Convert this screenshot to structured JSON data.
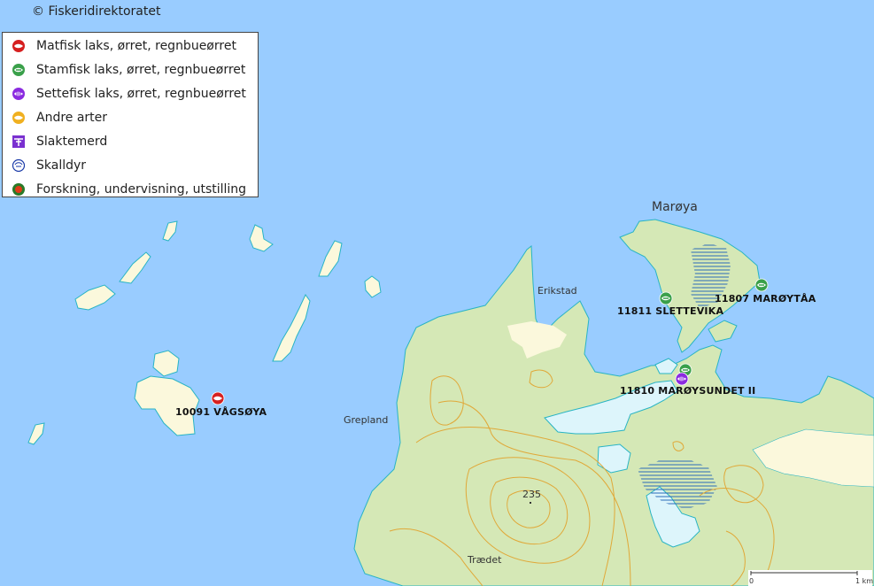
{
  "map": {
    "copyright": "© Fiskeridirektoratet",
    "colors": {
      "sea": "#99ccff",
      "land": "#d5e8b6",
      "open_land": "#fbf8dc",
      "lake": "#ddf5fb",
      "contour": "#e0a838",
      "coast": "#28b4c4"
    }
  },
  "legend": {
    "items": [
      {
        "label": "Matfisk laks, ørret, regnbueørret",
        "icon": "matfisk-icon",
        "color": "#d62020"
      },
      {
        "label": "Stamfisk laks, ørret, regnbueørret",
        "icon": "stamfisk-icon",
        "color": "#3aa04a"
      },
      {
        "label": "Settefisk laks, ørret, regnbueørret",
        "icon": "settefisk-icon",
        "color": "#8b2be0"
      },
      {
        "label": "Andre arter",
        "icon": "andre-arter-icon",
        "color": "#f0b020"
      },
      {
        "label": "Slaktemerd",
        "icon": "slaktemerd-icon",
        "color": "#7a30d0"
      },
      {
        "label": "Skalldyr",
        "icon": "skalldyr-icon",
        "color": "#1a3aa8"
      },
      {
        "label": "Forskning, undervisning, utstilling",
        "icon": "forskning-icon",
        "color": "#e03a18"
      }
    ]
  },
  "places": {
    "maroya": "Marøya",
    "erikstad": "Erikstad",
    "grepland": "Grepland",
    "traedet": "Trædet",
    "elevation": "235"
  },
  "sites": {
    "vagsoya": {
      "label": "10091 VÅGSØYA",
      "type": "Matfisk"
    },
    "slettevika": {
      "label": "11811 SLETTEVIKA",
      "type": "Stamfisk"
    },
    "maroytaa": {
      "label": "11807 MARØYTÅA",
      "type": "Stamfisk"
    },
    "maroysundet_stamfisk": {
      "type": "Stamfisk"
    },
    "maroysundet": {
      "label": "11810 MARØYSUNDET II",
      "type": "Settefisk"
    }
  },
  "scale": {
    "start": "0",
    "end": "1 km"
  }
}
